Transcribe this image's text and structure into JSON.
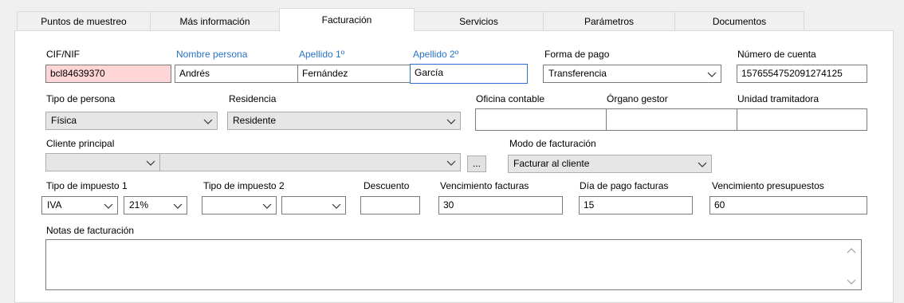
{
  "tabs": [
    {
      "label": "Puntos de muestreo"
    },
    {
      "label": "Más información"
    },
    {
      "label": "Facturación"
    },
    {
      "label": "Servicios"
    },
    {
      "label": "Parámetros"
    },
    {
      "label": "Documentos"
    }
  ],
  "active_tab": "Facturación",
  "fields": {
    "cif": {
      "label": "CIF/NIF",
      "value": "bcl84639370"
    },
    "nombre": {
      "label": "Nombre persona",
      "value": "Andrés"
    },
    "apellido1": {
      "label": "Apellido 1º",
      "value": "Fernández"
    },
    "apellido2": {
      "label": "Apellido 2º",
      "value": "García"
    },
    "forma_pago": {
      "label": "Forma de pago",
      "value": "Transferencia"
    },
    "numero_cuenta": {
      "label": "Número de cuenta",
      "value": "1576554752091274125"
    },
    "tipo_persona": {
      "label": "Tipo de persona",
      "value": "Física"
    },
    "residencia": {
      "label": "Residencia",
      "value": "Residente"
    },
    "oficina_contable": {
      "label": "Oficina contable",
      "value": ""
    },
    "organo_gestor": {
      "label": "Órgano gestor",
      "value": ""
    },
    "unidad_tramitadora": {
      "label": "Unidad tramitadora",
      "value": ""
    },
    "cliente_principal": {
      "label": "Cliente principal",
      "value": ""
    },
    "cliente_dots": {
      "label": "..."
    },
    "modo_facturacion": {
      "label": "Modo de facturación",
      "value": "Facturar al cliente"
    },
    "tipo_impuesto1": {
      "label": "Tipo de impuesto 1",
      "value": "IVA",
      "pct": "21%"
    },
    "tipo_impuesto2": {
      "label": "Tipo de impuesto 2",
      "value": ""
    },
    "descuento": {
      "label": "Descuento",
      "value": ""
    },
    "vencimiento_facturas": {
      "label": "Vencimiento facturas",
      "value": "30"
    },
    "dia_pago": {
      "label": "Día de pago facturas",
      "value": "15"
    },
    "vencimiento_presupuestos": {
      "label": "Vencimiento presupuestos",
      "value": "60"
    },
    "notas": {
      "label": "Notas de facturación",
      "value": ""
    }
  },
  "colors": {
    "highlight_label": "#2a73c8",
    "invalid_field": "#ffd6d6"
  }
}
